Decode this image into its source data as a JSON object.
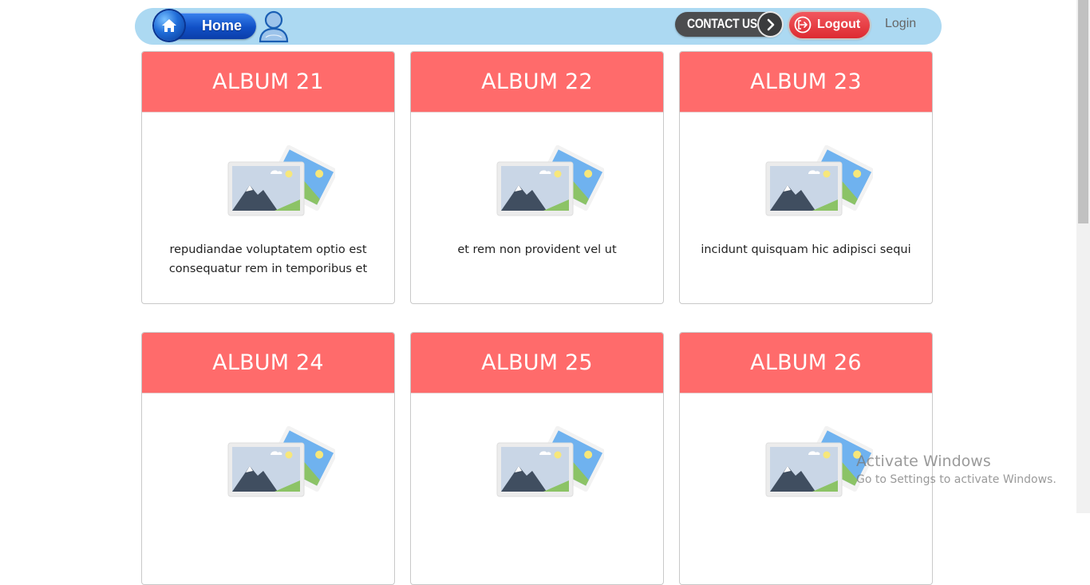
{
  "nav": {
    "home_label": "Home",
    "contact_label": "CONTACT US",
    "logout_label": "Logout",
    "login_label": "Login"
  },
  "albums": [
    {
      "title": "ALBUM 21",
      "description": "repudiandae voluptatem optio est consequatur rem in temporibus et",
      "image_icon": "photo-gallery-icon"
    },
    {
      "title": "ALBUM 22",
      "description": "et rem non provident vel ut",
      "image_icon": "photo-gallery-icon"
    },
    {
      "title": "ALBUM 23",
      "description": "incidunt quisquam hic adipisci sequi",
      "image_icon": "photo-gallery-icon"
    },
    {
      "title": "ALBUM 24",
      "description": "",
      "image_icon": "photo-gallery-icon"
    },
    {
      "title": "ALBUM 25",
      "description": "",
      "image_icon": "photo-gallery-icon"
    },
    {
      "title": "ALBUM 26",
      "description": "",
      "image_icon": "photo-gallery-icon"
    }
  ],
  "watermark": {
    "title": "Activate Windows",
    "subtitle": "Go to Settings to activate Windows."
  },
  "colors": {
    "navbar_bg": "#acd9f2",
    "card_header": "#ff6b6b",
    "logout_red": "#dd2a31",
    "contact_dark": "#4c4d4f"
  }
}
